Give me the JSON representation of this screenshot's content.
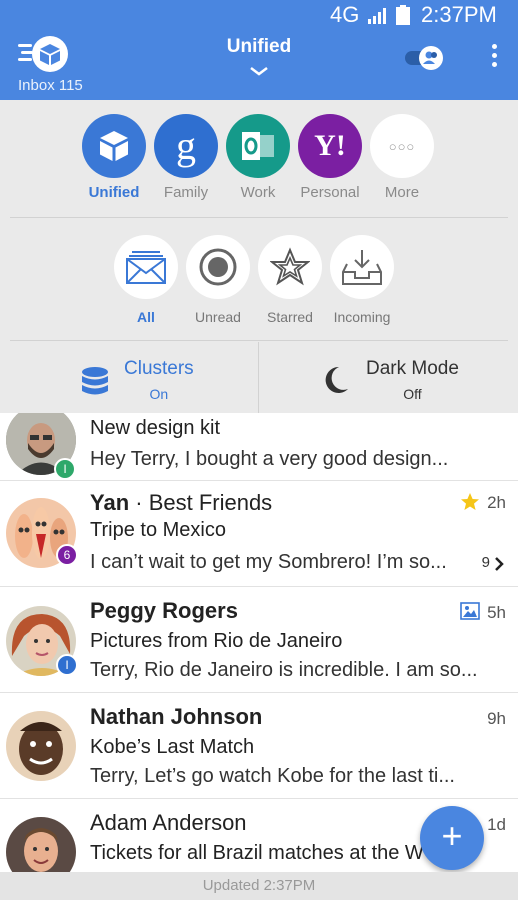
{
  "status_bar": {
    "network": "4G",
    "time": "2:37PM"
  },
  "header": {
    "inbox_label": "Inbox 115",
    "title": "Unified"
  },
  "accounts": [
    {
      "label": "Unified",
      "active": true,
      "color": "#3a78d6"
    },
    {
      "label": "Family",
      "active": false,
      "color": "#2f6fd0",
      "glyph": "g"
    },
    {
      "label": "Work",
      "active": false,
      "color": "#159a8a"
    },
    {
      "label": "Personal",
      "active": false,
      "color": "#7b1fa2",
      "glyph": "Y!"
    },
    {
      "label": "More",
      "active": false,
      "glyph": "○○○"
    }
  ],
  "filters": [
    {
      "label": "All",
      "active": true,
      "icon": "envelope-icon"
    },
    {
      "label": "Unread",
      "active": false,
      "icon": "record-icon"
    },
    {
      "label": "Starred",
      "active": false,
      "icon": "star-icon"
    },
    {
      "label": "Incoming",
      "active": false,
      "icon": "inbox-tray-icon"
    }
  ],
  "toggles": {
    "clusters": {
      "title": "Clusters",
      "state": "On"
    },
    "dark_mode": {
      "title": "Dark Mode",
      "state": "Off"
    }
  },
  "messages": [
    {
      "sender": "",
      "subject": "New design kit",
      "snippet": "Hey Terry, I bought a very good design...",
      "badge": "I",
      "badge_color": "#2ea86a"
    },
    {
      "sender": "Yan",
      "group": " · Best Friends",
      "subject": "Tripe to Mexico",
      "snippet": "I can’t wait to get my Sombrero! I’m so...",
      "time": "2h",
      "count": "9",
      "badge": "6",
      "badge_color": "#7b1fa2"
    },
    {
      "sender": "Peggy Rogers",
      "subject": "Pictures from Rio de Janeiro",
      "snippet": "Terry, Rio de Janeiro is incredible. I am so...",
      "time": "5h",
      "badge": "I",
      "badge_color": "#2f6fd0"
    },
    {
      "sender": "Nathan Johnson",
      "subject": "Kobe’s Last Match",
      "snippet": "Terry, Let’s go watch Kobe for the last ti...",
      "time": "9h"
    },
    {
      "sender": "Adam Anderson",
      "subject": "Tickets for all Brazil matches at the W",
      "snippet": "",
      "time": "1d"
    }
  ],
  "fab": {
    "label": "+"
  },
  "footer": {
    "updated": "Updated 2:37PM"
  },
  "colors": {
    "primary": "#4a86e0",
    "accent": "#3a78d6",
    "drawer_bg": "#eaeaea"
  }
}
